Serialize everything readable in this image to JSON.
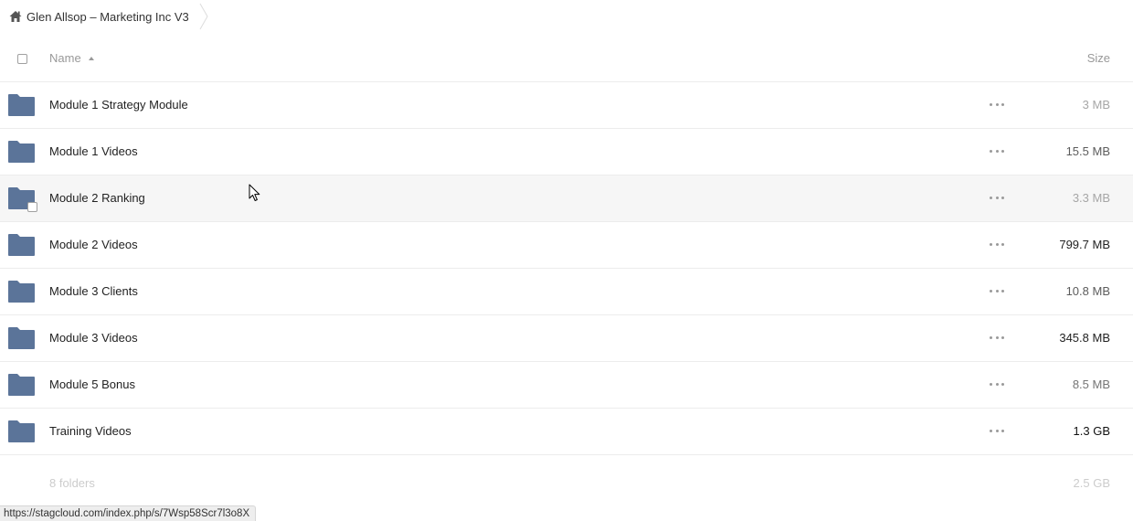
{
  "breadcrumb": {
    "home_icon": "home-icon",
    "label": "Glen Allsop – Marketing Inc V3"
  },
  "header": {
    "name_label": "Name",
    "size_label": "Size",
    "sort_icon": "sort-ascending-icon"
  },
  "colors": {
    "folder": "#5b7499",
    "text": "#222222",
    "muted": "#999999",
    "faint": "#cccccc",
    "hover_row": "#f6f6f6"
  },
  "files": [
    {
      "name": "Module 1 Strategy Module",
      "size": "3 MB",
      "size_color": "#a6a6a6"
    },
    {
      "name": "Module 1 Videos",
      "size": "15.5 MB",
      "size_color": "#5c5c5c"
    },
    {
      "name": "Module 2 Ranking",
      "size": "3.3 MB",
      "size_color": "#a6a6a6"
    },
    {
      "name": "Module 2 Videos",
      "size": "799.7 MB",
      "size_color": "#222222"
    },
    {
      "name": "Module 3 Clients",
      "size": "10.8 MB",
      "size_color": "#5c5c5c"
    },
    {
      "name": "Module 3 Videos",
      "size": "345.8 MB",
      "size_color": "#222222"
    },
    {
      "name": "Module 5 Bonus",
      "size": "8.5 MB",
      "size_color": "#757575"
    },
    {
      "name": "Training Videos",
      "size": "1.3 GB",
      "size_color": "#111111"
    }
  ],
  "hovered_index": 2,
  "summary": {
    "count": "8 folders",
    "size": "2.5 GB"
  },
  "status_bar": {
    "url": "https://stagcloud.com/index.php/s/7Wsp58Scr7l3o8X"
  }
}
